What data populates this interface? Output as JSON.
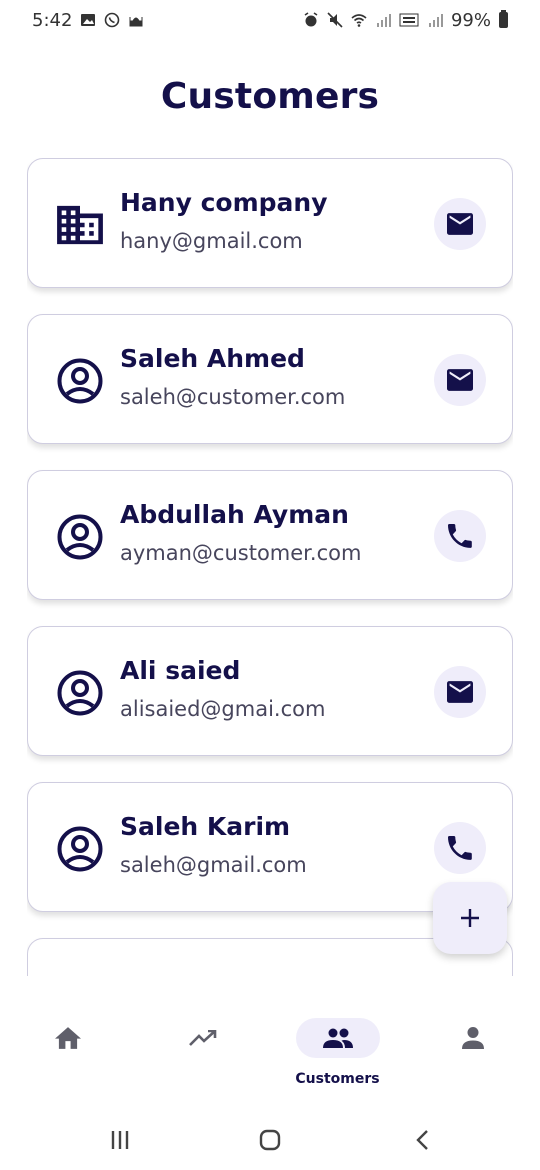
{
  "status_bar": {
    "time": "5:42",
    "battery": "99%"
  },
  "page": {
    "title": "Customers"
  },
  "customers": [
    {
      "name": "Hany company",
      "email": "hany@gmail.com",
      "lead_icon": "business-icon",
      "action_icon": "mail-icon"
    },
    {
      "name": "Saleh Ahmed",
      "email": "saleh@customer.com",
      "lead_icon": "account-circle-icon",
      "action_icon": "mail-icon"
    },
    {
      "name": "Abdullah Ayman",
      "email": "ayman@customer.com",
      "lead_icon": "account-circle-icon",
      "action_icon": "phone-icon"
    },
    {
      "name": "Ali saied",
      "email": "alisaied@gmai.com",
      "lead_icon": "account-circle-icon",
      "action_icon": "mail-icon"
    },
    {
      "name": "Saleh Karim",
      "email": "saleh@gmail.com",
      "lead_icon": "account-circle-icon",
      "action_icon": "phone-icon"
    }
  ],
  "fab": {
    "icon": "add-icon"
  },
  "bottom_nav": {
    "items": [
      {
        "icon": "home-icon",
        "label": ""
      },
      {
        "icon": "trending-up-icon",
        "label": ""
      },
      {
        "icon": "people-icon",
        "label": "Customers",
        "active": true
      },
      {
        "icon": "person-icon",
        "label": ""
      }
    ]
  },
  "colors": {
    "primary": "#14104a",
    "secondary_text": "#47455c",
    "container": "#efedfa",
    "icon_inactive": "#5f5f6a"
  }
}
